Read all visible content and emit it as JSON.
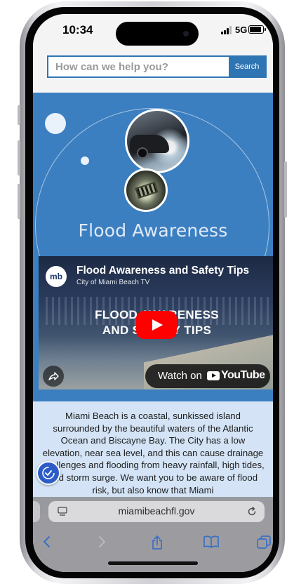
{
  "status_bar": {
    "time": "10:34",
    "network": "5G",
    "battery_level": 0.9
  },
  "search": {
    "placeholder": "How can we help you?",
    "button_label": "Search"
  },
  "hero": {
    "title": "Flood Awareness"
  },
  "video": {
    "channel_logo_text": "mb",
    "title": "Flood Awareness and Safety Tips",
    "channel": "City of Miami Beach TV",
    "overlay_line1": "FLOOD AWARENESS",
    "overlay_line2": "AND SAFETY TIPS",
    "watch_label": "Watch on",
    "youtube_wordmark": "YouTube"
  },
  "content": {
    "text": "Miami Beach is a coastal, sunkissed island surrounded by the beautiful waters of the Atlantic Ocean and Biscayne Bay. The City has a low elevation, near sea level, and this can cause drainage challenges and flooding from heavy rainfall, high tides, and storm surge. We want you to be aware of flood risk, but also know that Miami"
  },
  "browser": {
    "url": "miamibeachfl.gov"
  },
  "colors": {
    "brand_blue": "#3b7fc1",
    "search_blue": "#2f74b3",
    "content_bg": "#d4e4f6",
    "play_red": "#ff0000"
  },
  "icons": {
    "toolbar": [
      "back-icon",
      "forward-icon",
      "share-icon",
      "bookmarks-icon",
      "tabs-icon"
    ],
    "address_bar": [
      "page-settings-icon",
      "reload-icon"
    ],
    "overlay": [
      "accessibility-icon",
      "video-share-icon",
      "youtube-play-icon"
    ]
  }
}
